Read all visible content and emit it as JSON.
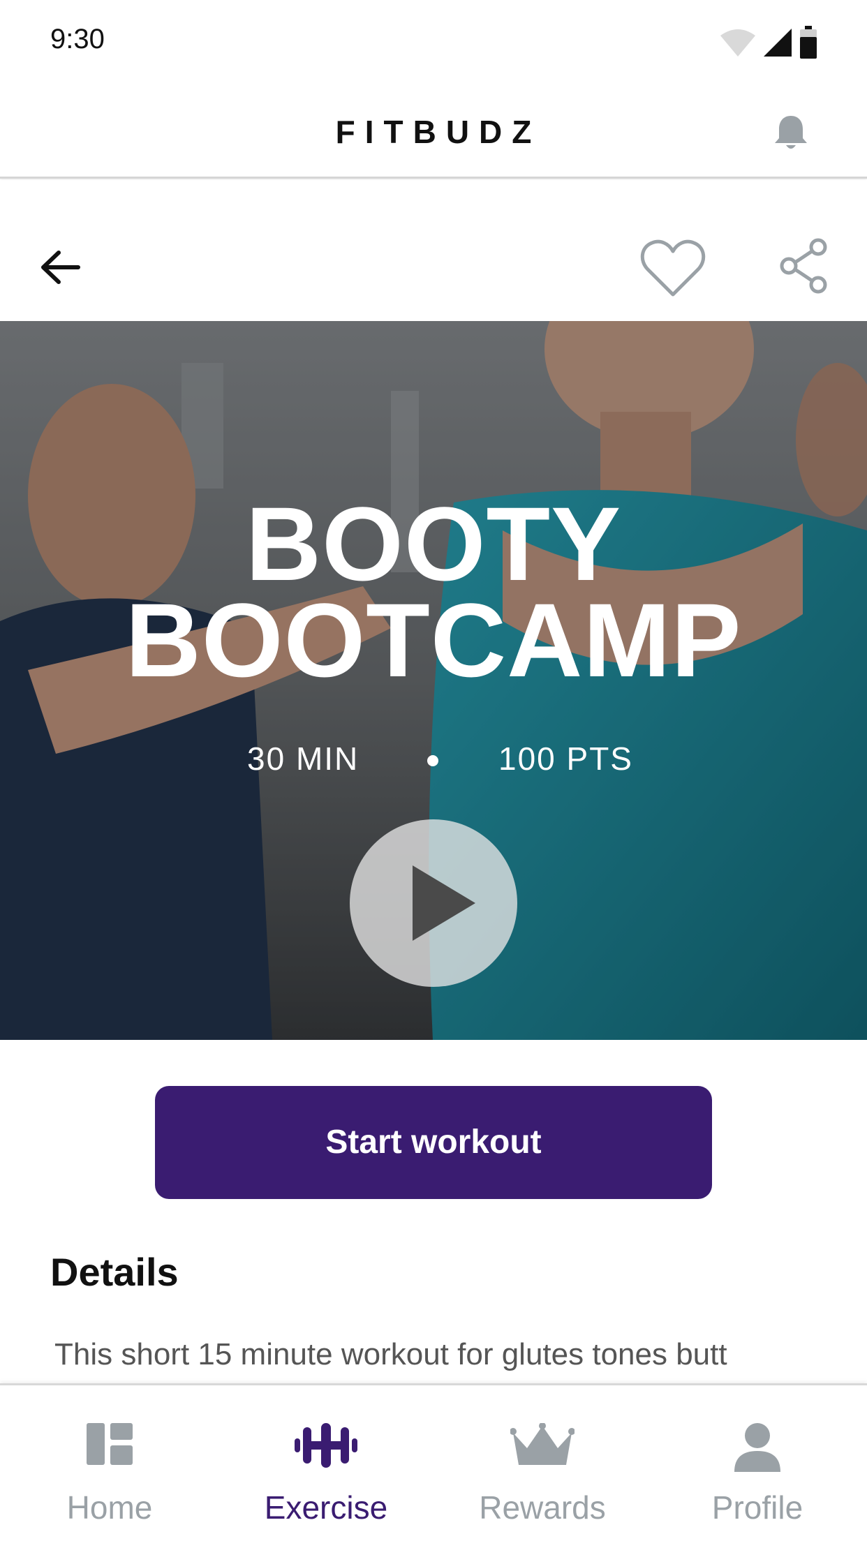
{
  "status_bar": {
    "time": "9:30"
  },
  "app_bar": {
    "title": "FITBUDZ"
  },
  "workout": {
    "title_line1": "BOOTY",
    "title_line2": "BOOTCAMP",
    "duration": "30 MIN",
    "points": "100 PTS"
  },
  "actions": {
    "start_label": "Start workout"
  },
  "details": {
    "heading": "Details",
    "text": "This short 15 minute workout for glutes tones butt"
  },
  "bottom_nav": {
    "items": [
      {
        "label": "Home",
        "icon": "home-icon",
        "active": false
      },
      {
        "label": "Exercise",
        "icon": "dumbbell-icon",
        "active": true
      },
      {
        "label": "Rewards",
        "icon": "crown-icon",
        "active": false
      },
      {
        "label": "Profile",
        "icon": "profile-icon",
        "active": false
      }
    ]
  },
  "colors": {
    "brand_purple": "#3a1c71",
    "inactive_gray": "#9aa1a6",
    "hero_teal": "#1f8fa3"
  }
}
